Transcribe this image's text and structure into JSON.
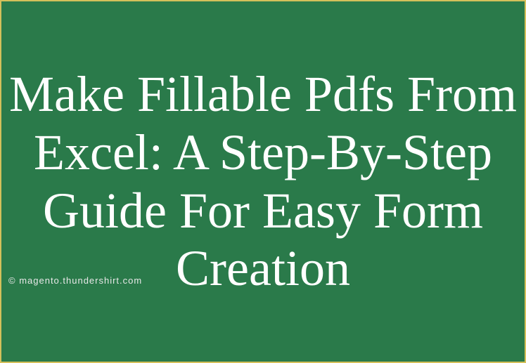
{
  "title": "Make Fillable Pdfs From Excel: A Step-By-Step Guide For Easy Form Creation",
  "watermark": "© magento.thundershirt.com"
}
